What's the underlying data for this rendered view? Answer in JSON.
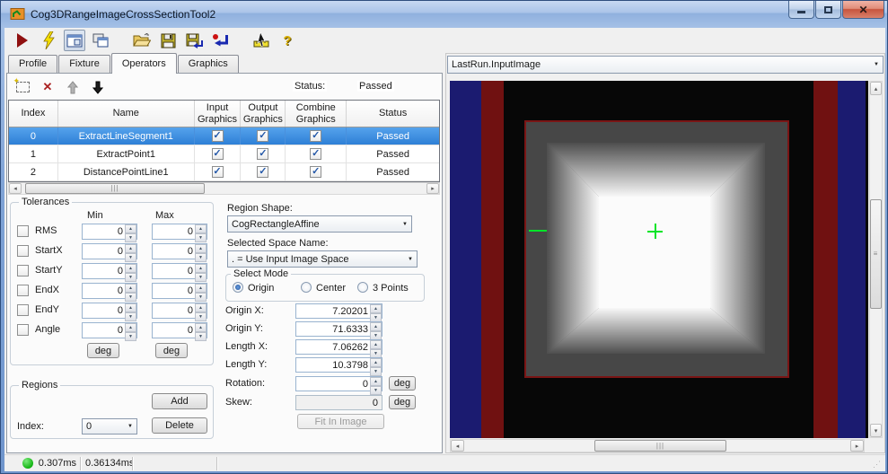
{
  "window": {
    "title": "Cog3DRangeImageCrossSectionTool2"
  },
  "toolbar": {
    "icons": [
      "run",
      "lightning",
      "tool-image-display",
      "cascade-windows",
      "open-file",
      "save",
      "save-as",
      "import-results",
      "pointer-measure",
      "help"
    ]
  },
  "tabs": {
    "items": [
      {
        "label": "Profile"
      },
      {
        "label": "Fixture"
      },
      {
        "label": "Operators"
      },
      {
        "label": "Graphics"
      }
    ],
    "selected": "Operators"
  },
  "operators": {
    "status_label": "Status:",
    "status_value": "Passed",
    "table": {
      "headers": {
        "index": "Index",
        "name": "Name",
        "input": "Input Graphics",
        "output": "Output Graphics",
        "combine": "Combine Graphics",
        "status": "Status"
      },
      "rows": [
        {
          "index": "0",
          "name": "ExtractLineSegment1",
          "input_checked": true,
          "output_checked": true,
          "combine_checked": true,
          "status": "Passed",
          "selected": true
        },
        {
          "index": "1",
          "name": "ExtractPoint1",
          "input_checked": true,
          "output_checked": true,
          "combine_checked": true,
          "status": "Passed",
          "selected": false
        },
        {
          "index": "2",
          "name": "DistancePointLine1",
          "input_checked": true,
          "output_checked": true,
          "combine_checked": true,
          "status": "Passed",
          "selected": false
        }
      ]
    }
  },
  "tolerances": {
    "title": "Tolerances",
    "min_header": "Min",
    "max_header": "Max",
    "deg_label": "deg",
    "rows": [
      {
        "label": "RMS",
        "min": "0",
        "max": "0",
        "checked": false
      },
      {
        "label": "StartX",
        "min": "0",
        "max": "0",
        "checked": false
      },
      {
        "label": "StartY",
        "min": "0",
        "max": "0",
        "checked": false
      },
      {
        "label": "EndX",
        "min": "0",
        "max": "0",
        "checked": false
      },
      {
        "label": "EndY",
        "min": "0",
        "max": "0",
        "checked": false
      },
      {
        "label": "Angle",
        "min": "0",
        "max": "0",
        "checked": false
      }
    ]
  },
  "regions": {
    "title": "Regions",
    "index_label": "Index:",
    "index_value": "0",
    "add_label": "Add",
    "delete_label": "Delete"
  },
  "region_shape": {
    "label": "Region Shape:",
    "value": "CogRectangleAffine"
  },
  "space": {
    "label": "Selected Space Name:",
    "value": ". = Use Input Image Space"
  },
  "select_mode": {
    "title": "Select Mode",
    "options": [
      {
        "label": "Origin"
      },
      {
        "label": "Center"
      },
      {
        "label": "3 Points"
      }
    ],
    "selected": "Origin"
  },
  "params": {
    "deg_label": "deg",
    "fit_button_label": "Fit In Image",
    "rows": [
      {
        "label": "Origin X:",
        "value": "7.20201"
      },
      {
        "label": "Origin Y:",
        "value": "71.6333"
      },
      {
        "label": "Length X:",
        "value": "7.06262"
      },
      {
        "label": "Length Y:",
        "value": "10.3798"
      },
      {
        "label": "Rotation:",
        "value": "0"
      },
      {
        "label": "Skew:",
        "value": "0"
      }
    ]
  },
  "display": {
    "selector_value": "LastRun.InputImage"
  },
  "status_bar": {
    "time_1": "0.307ms",
    "time_2": "0.36134ms"
  },
  "colors": {
    "selection_blue": "#3d8fe0",
    "overlay_green": "#00e428",
    "band_blue": "#1b1b70",
    "band_red": "#701111",
    "status_green": "#12b412"
  }
}
